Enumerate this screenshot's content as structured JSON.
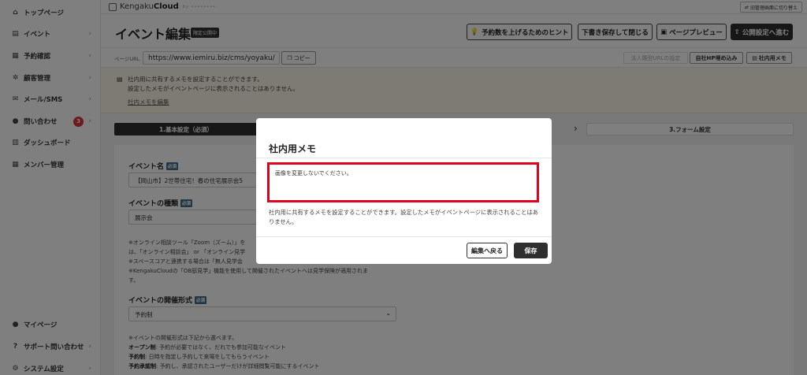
{
  "sidebar": {
    "items": [
      {
        "label": "トップページ",
        "icon": "home-icon",
        "glyph": "⌂",
        "chevron": false
      },
      {
        "label": "イベント",
        "icon": "document-icon",
        "glyph": "▤",
        "chevron": true
      },
      {
        "label": "予約確認",
        "icon": "calendar-icon",
        "glyph": "▦",
        "chevron": true
      },
      {
        "label": "顧客管理",
        "icon": "people-icon",
        "glyph": "✲",
        "chevron": true
      },
      {
        "label": "メール/SMS",
        "icon": "mail-icon",
        "glyph": "✉",
        "chevron": true
      },
      {
        "label": "問い合わせ",
        "icon": "chat-icon",
        "glyph": "●",
        "chevron": true,
        "badge": "3"
      },
      {
        "label": "ダッシュボード",
        "icon": "chart-icon",
        "glyph": "▥",
        "chevron": false
      },
      {
        "label": "メンバー管理",
        "icon": "grid-icon",
        "glyph": "▦",
        "chevron": false
      }
    ],
    "bottom_items": [
      {
        "label": "マイページ",
        "icon": "user-icon",
        "glyph": "●",
        "chevron": false
      },
      {
        "label": "サポート問い合わせ",
        "icon": "help-icon",
        "glyph": "?",
        "chevron": true
      },
      {
        "label": "システム設定",
        "icon": "gear-icon",
        "glyph": "⚙",
        "chevron": true
      }
    ]
  },
  "topbar": {
    "logo_prefix": "Kengaku",
    "logo_bold": "Cloud",
    "logo_tag": "by ••••••••",
    "switch_label": "旧管理画面に切り替え"
  },
  "header": {
    "title": "イベント編集",
    "status_badge": "限定公開中",
    "buttons": {
      "hint": "予約数を上げるためのヒント",
      "save_close": "下書き保存して閉じる",
      "preview": "ページプレビュー",
      "publish": "公開設定へ進む"
    }
  },
  "url_bar": {
    "label": "ページURL",
    "value": "https://www.iemiru.biz/cms/yoyaku/",
    "copy_label": "コピー",
    "corporate_url": "法人雛型URLの設定",
    "embed": "自社HP埋め込み",
    "internal_memo": "社内用メモ"
  },
  "memo_notice": {
    "line1": "社内用に共有するメモを設定することができます。",
    "line2": "設定したメモがイベントページに表示されることはありません。",
    "link": "社内メモを編集"
  },
  "steps": {
    "step1": "1.基本設定（必須）",
    "step3": "3.フォーム設定"
  },
  "form": {
    "event_name_label": "イベント名",
    "required": "必須",
    "event_name_value": "【岡山市】2世帯住宅！春の住宅展示会5",
    "event_type_label": "イベントの種類",
    "event_type_value": "展示会",
    "notes_type": [
      "※オンライン相談ツール「Zoom（ズーム）」を",
      "は、「オンライン相談会」 or 「オンライン見学",
      "※スペースコアと連携する場合は「無人見学会",
      "※KengakuCloudの「OB邸見学」機能を使用して開催されたイベントへは見学保険が適用されま",
      "す。"
    ],
    "format_label": "イベントの開催形式",
    "format_value": "予約制",
    "format_notes": [
      {
        "bold": "",
        "text": "※イベントの開催形式は下記から選べます。"
      },
      {
        "bold": "オープン制",
        "text": ": 予約が必要ではなく、だれでも参加可能なイベント"
      },
      {
        "bold": "予約制",
        "text": ": 日時を指定し予約して来場をしてもらうイベント"
      },
      {
        "bold": "予約承認制",
        "text": ": 予約し、承認されたユーザーだけが詳細閲覧可能にするイベント"
      }
    ]
  },
  "modal": {
    "title": "社内用メモ",
    "memo_value": "画像を変更しないでください。",
    "description": "社内用に共有するメモを設定することができます。設定したメモがイベントページに表示されることはありません。",
    "back_label": "編集へ戻る",
    "save_label": "保存"
  },
  "colors": {
    "accent_dark": "#2f2f2f",
    "highlight_red": "#e0001b",
    "badge_red": "#d9363e",
    "notice_bg": "#fbf6e7"
  }
}
